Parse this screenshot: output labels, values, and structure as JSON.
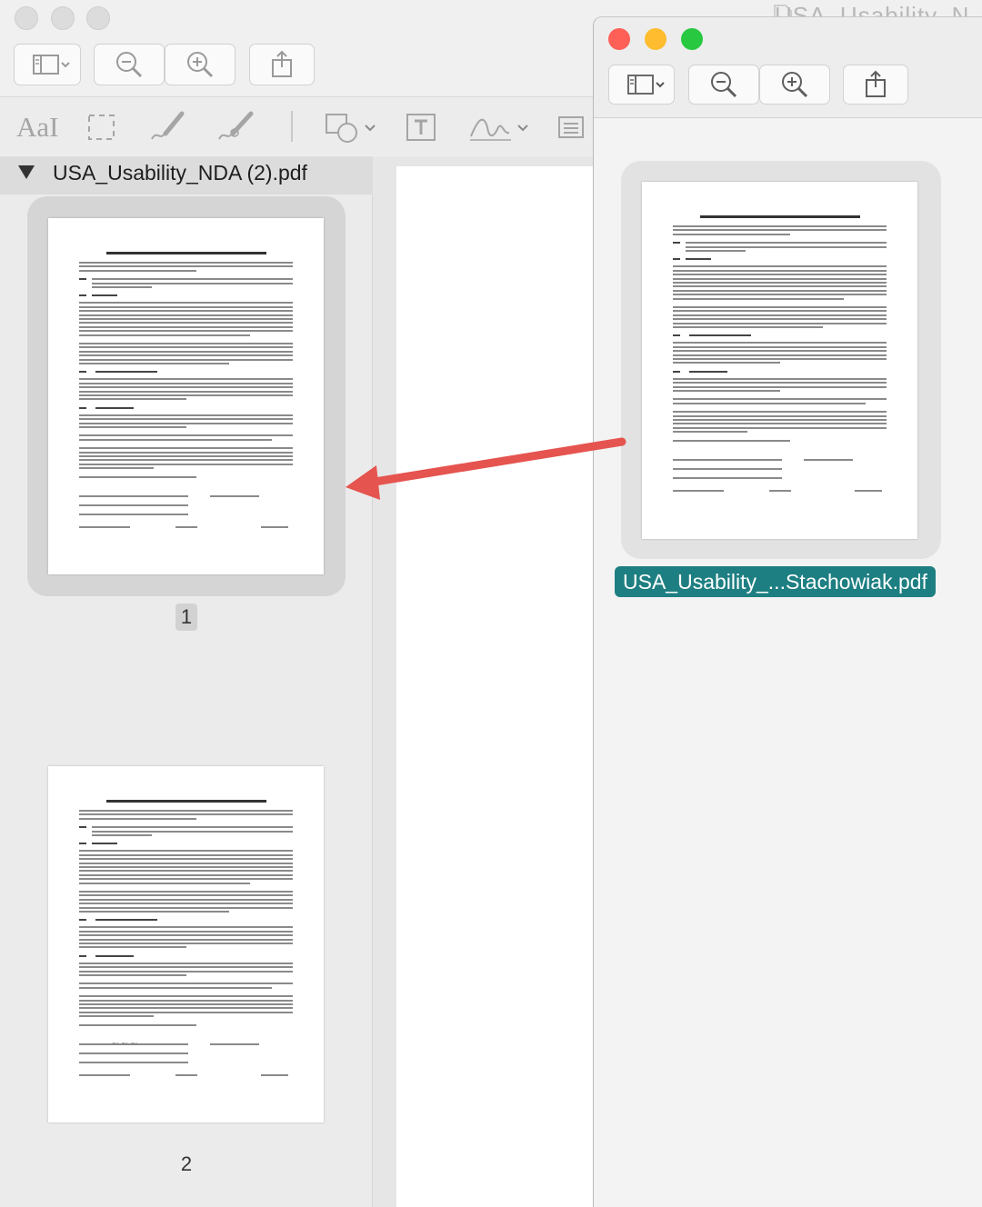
{
  "back_window": {
    "title": "USA_Usability_N",
    "sidebar": {
      "file_name": "USA_Usability_NDA (2).pdf",
      "pages": [
        {
          "number": "1",
          "selected": true
        },
        {
          "number": "2",
          "selected": false
        }
      ]
    },
    "markup_toolbar": {
      "text_style_label": "AaI"
    }
  },
  "front_window": {
    "file": {
      "label": "USA_Usability_...Stachowiak.pdf",
      "selected": true
    }
  },
  "colors": {
    "arrow": "#e5544f",
    "file_label_bg": "#1e7f82",
    "traffic_close": "#fe5f57",
    "traffic_min": "#febc2e",
    "traffic_max": "#28c840"
  }
}
